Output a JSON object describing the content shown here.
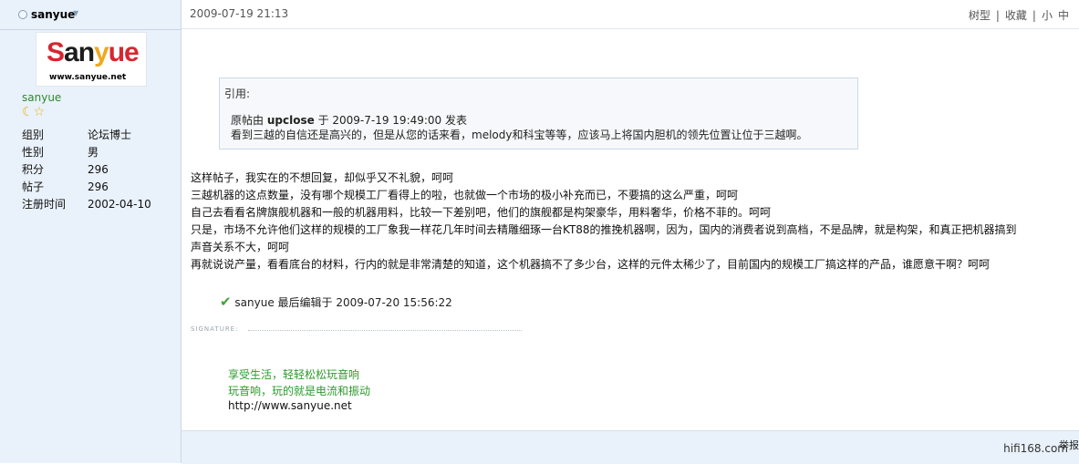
{
  "author": {
    "name": "sanyue",
    "avatar_brand": "Sanyue",
    "avatar_url": "www.sanyue.net",
    "display_name": "sanyue",
    "profile": [
      {
        "key": "组别",
        "value": "论坛博士"
      },
      {
        "key": "性别",
        "value": "男"
      },
      {
        "key": "积分",
        "value": "296"
      },
      {
        "key": "帖子",
        "value": "296"
      },
      {
        "key": "注册时间",
        "value": "2002-04-10"
      }
    ]
  },
  "post": {
    "date": "2009-07-19 21:13",
    "actions": [
      "树型",
      "|",
      "收藏",
      "|",
      "小",
      "中"
    ],
    "quote": {
      "title": "引用:",
      "prefix": "原帖由",
      "user": "upclose",
      "suffix": "于 2009-7-19 19:49:00 发表",
      "text": "看到三越的自信还是高兴的，但是从您的话来看，melody和科宝等等，应该马上将国内胆机的领先位置让位于三越啊。"
    },
    "body": [
      "这样帖子，我实在的不想回复，却似乎又不礼貌，呵呵",
      "三越机器的这点数量，没有哪个规模工厂看得上的啦，也就做一个市场的极小补充而已，不要搞的这么严重，呵呵",
      "自己去看看名牌旗舰机器和一般的机器用料，比较一下差别吧，他们的旗舰都是构架豪华，用料奢华，价格不菲的。呵呵",
      "只是，市场不允许他们这样的规模的工厂象我一样花几年时间去精雕细琢一台KT88的推挽机器啊，因为，国内的消费者说到高档，不是品牌，就是构架，和真正把机器搞到",
      "声音关系不大，呵呵",
      "再就说说产量，看看底台的材料，行内的就是非常清楚的知道，这个机器搞不了多少台，这样的元件太稀少了，目前国内的规模工厂搞这样的产品，谁愿意干啊？呵呵"
    ],
    "edit_note": "sanyue 最后编辑于 2009-07-20 15:56:22",
    "signature_label": "SIGNATURE:",
    "signature": {
      "line1": "享受生活，轻轻松松玩音响",
      "line2": "玩音响，玩的就是电流和振动",
      "link": "http://www.sanyue.net"
    },
    "report": "举报"
  },
  "watermark": "hifi168.com",
  "colors": {
    "sidebar_bg": "#e9f1fa",
    "green": "#2e9a2e",
    "logo_red": "#d8262e",
    "logo_yellow": "#f0a81e"
  },
  "icons": [
    "online-status-icon",
    "caret-down-icon",
    "rank-moon-icon",
    "rank-star-icon",
    "check-icon"
  ]
}
